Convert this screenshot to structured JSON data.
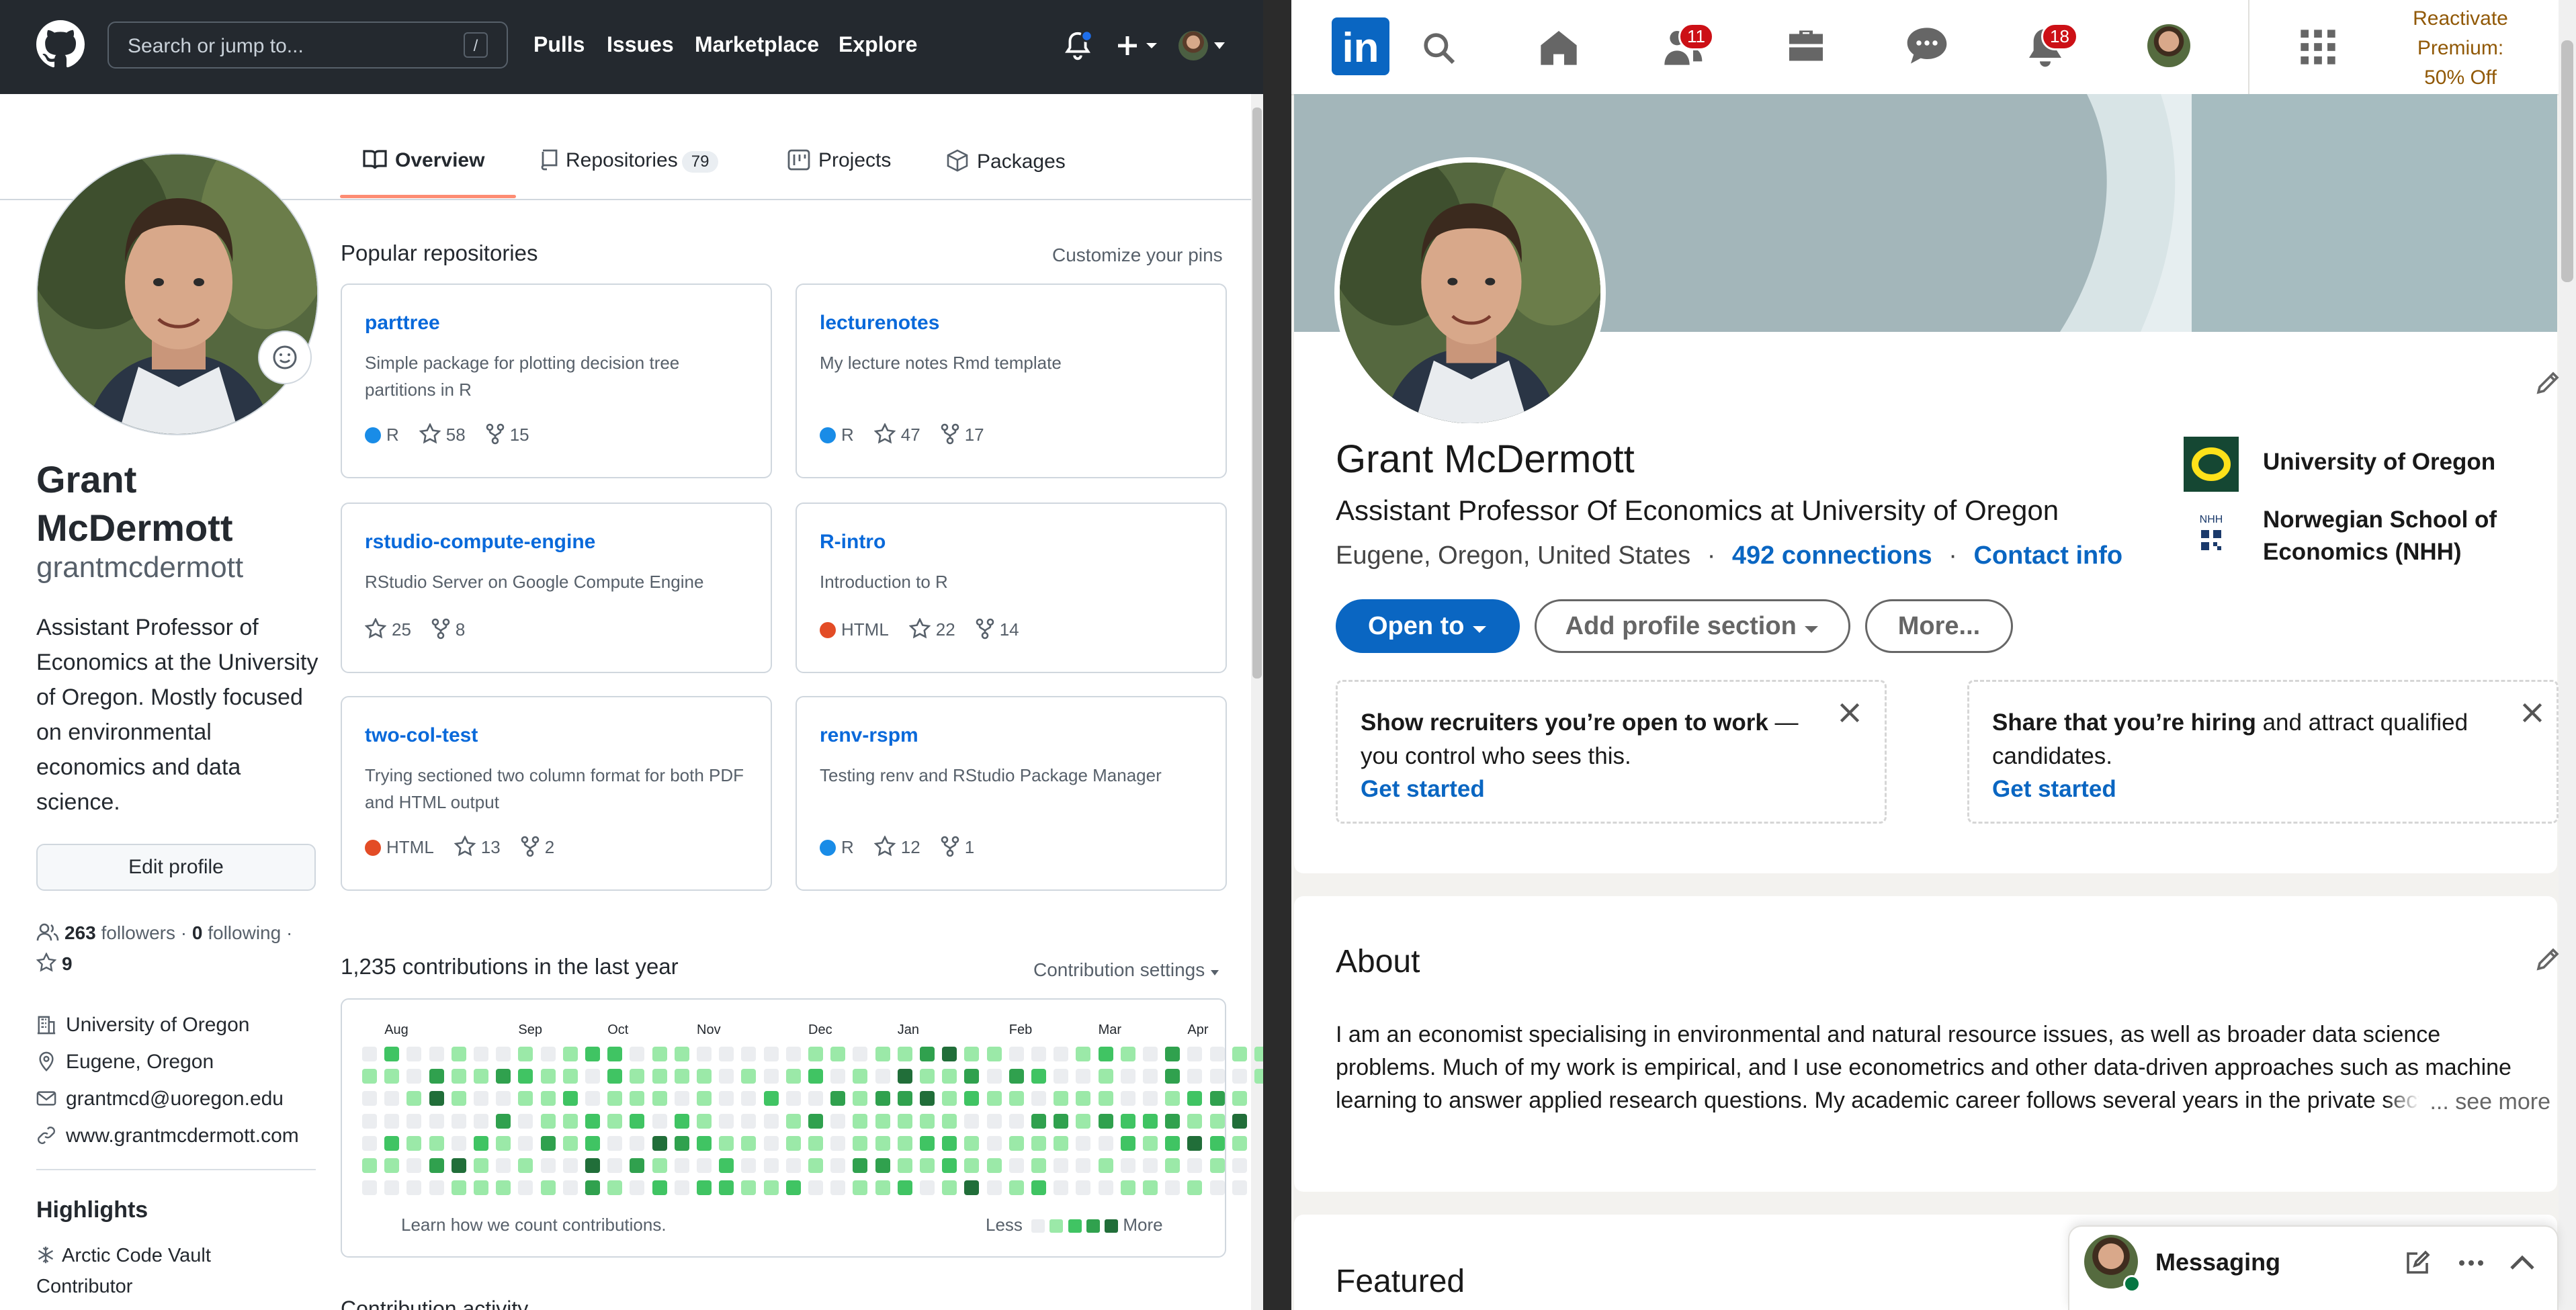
{
  "github": {
    "search_placeholder": "Search or jump to...",
    "slash_key": "/",
    "nav": [
      "Pulls",
      "Issues",
      "Marketplace",
      "Explore"
    ],
    "tabs": {
      "overview": "Overview",
      "repositories": "Repositories",
      "repositories_count": "79",
      "projects": "Projects",
      "packages": "Packages"
    },
    "profile": {
      "name_line1": "Grant",
      "name_line2": "McDermott",
      "username": "grantmcdermott",
      "bio": "Assistant Professor of Economics at the University of Oregon. Mostly focused on environmental economics and data science.",
      "edit_button": "Edit profile",
      "followers_count": "263",
      "followers_label": "followers",
      "following_count": "0",
      "following_label": "following",
      "stars_count": "9",
      "org": "University of Oregon",
      "location": "Eugene, Oregon",
      "email": "grantmcd@uoregon.edu",
      "website": "www.grantmcdermott.com",
      "highlights_title": "Highlights",
      "highlight_item": "Arctic Code Vault Contributor"
    },
    "popular": {
      "title": "Popular repositories",
      "customize": "Customize your pins",
      "repos": [
        {
          "name": "parttree",
          "desc": "Simple package for plotting decision tree partitions in R",
          "lang": "R",
          "lang_color": "#198ce7",
          "stars": "58",
          "forks": "15"
        },
        {
          "name": "lecturenotes",
          "desc": "My lecture notes Rmd template",
          "lang": "R",
          "lang_color": "#198ce7",
          "stars": "47",
          "forks": "17"
        },
        {
          "name": "rstudio-compute-engine",
          "desc": "RStudio Server on Google Compute Engine",
          "lang": "",
          "lang_color": "",
          "stars": "25",
          "forks": "8"
        },
        {
          "name": "R-intro",
          "desc": "Introduction to R",
          "lang": "HTML",
          "lang_color": "#e34c26",
          "stars": "22",
          "forks": "14"
        },
        {
          "name": "two-col-test",
          "desc": "Trying sectioned two column format for both PDF and HTML output",
          "lang": "HTML",
          "lang_color": "#e34c26",
          "stars": "13",
          "forks": "2"
        },
        {
          "name": "renv-rspm",
          "desc": "Testing renv and RStudio Package Manager",
          "lang": "R",
          "lang_color": "#198ce7",
          "stars": "12",
          "forks": "1"
        }
      ]
    },
    "contributions": {
      "title": "1,235 contributions in the last year",
      "settings": "Contribution settings",
      "months": [
        "Aug",
        "Sep",
        "Oct",
        "Nov",
        "Dec",
        "Jan",
        "Feb",
        "Mar",
        "Apr"
      ],
      "learn": "Learn how we count contributions.",
      "less": "Less",
      "more": "More",
      "activity_title": "Contribution activity"
    }
  },
  "linkedin": {
    "logo": "in",
    "network_badge": "11",
    "notifications_badge": "18",
    "premium_line1": "Reactivate",
    "premium_line2": "Premium:",
    "premium_line3": "50% Off",
    "name": "Grant McDermott",
    "headline": "Assistant Professor Of Economics at University of Oregon",
    "location": "Eugene, Oregon, United States",
    "connections": "492 connections",
    "contact": "Contact info",
    "sep": "·",
    "buttons": {
      "open_to": "Open to",
      "add_section": "Add profile section",
      "more": "More..."
    },
    "schools": [
      {
        "name": "University of Oregon"
      },
      {
        "name": "Norwegian School of Economics (NHH)",
        "logo_text": "NHH"
      }
    ],
    "open_to_work": {
      "bold": "Show recruiters you’re open to work",
      "rest": " — you control who sees this.",
      "link": "Get started"
    },
    "hiring": {
      "bold": "Share that you’re hiring",
      "rest": " and attract qualified candidates.",
      "link": "Get started"
    },
    "about": {
      "title": "About",
      "text": "I am an economist specialising in environmental and natural resource issues, as well as broader data science problems. Much of my work is empirical, and I use econometrics and other data-driven approaches such as machine learning to answer applied research questions. My academic career follows several years in the private sector, where I",
      "see_more": "... see more"
    },
    "featured_title": "Featured",
    "messaging": "Messaging"
  }
}
